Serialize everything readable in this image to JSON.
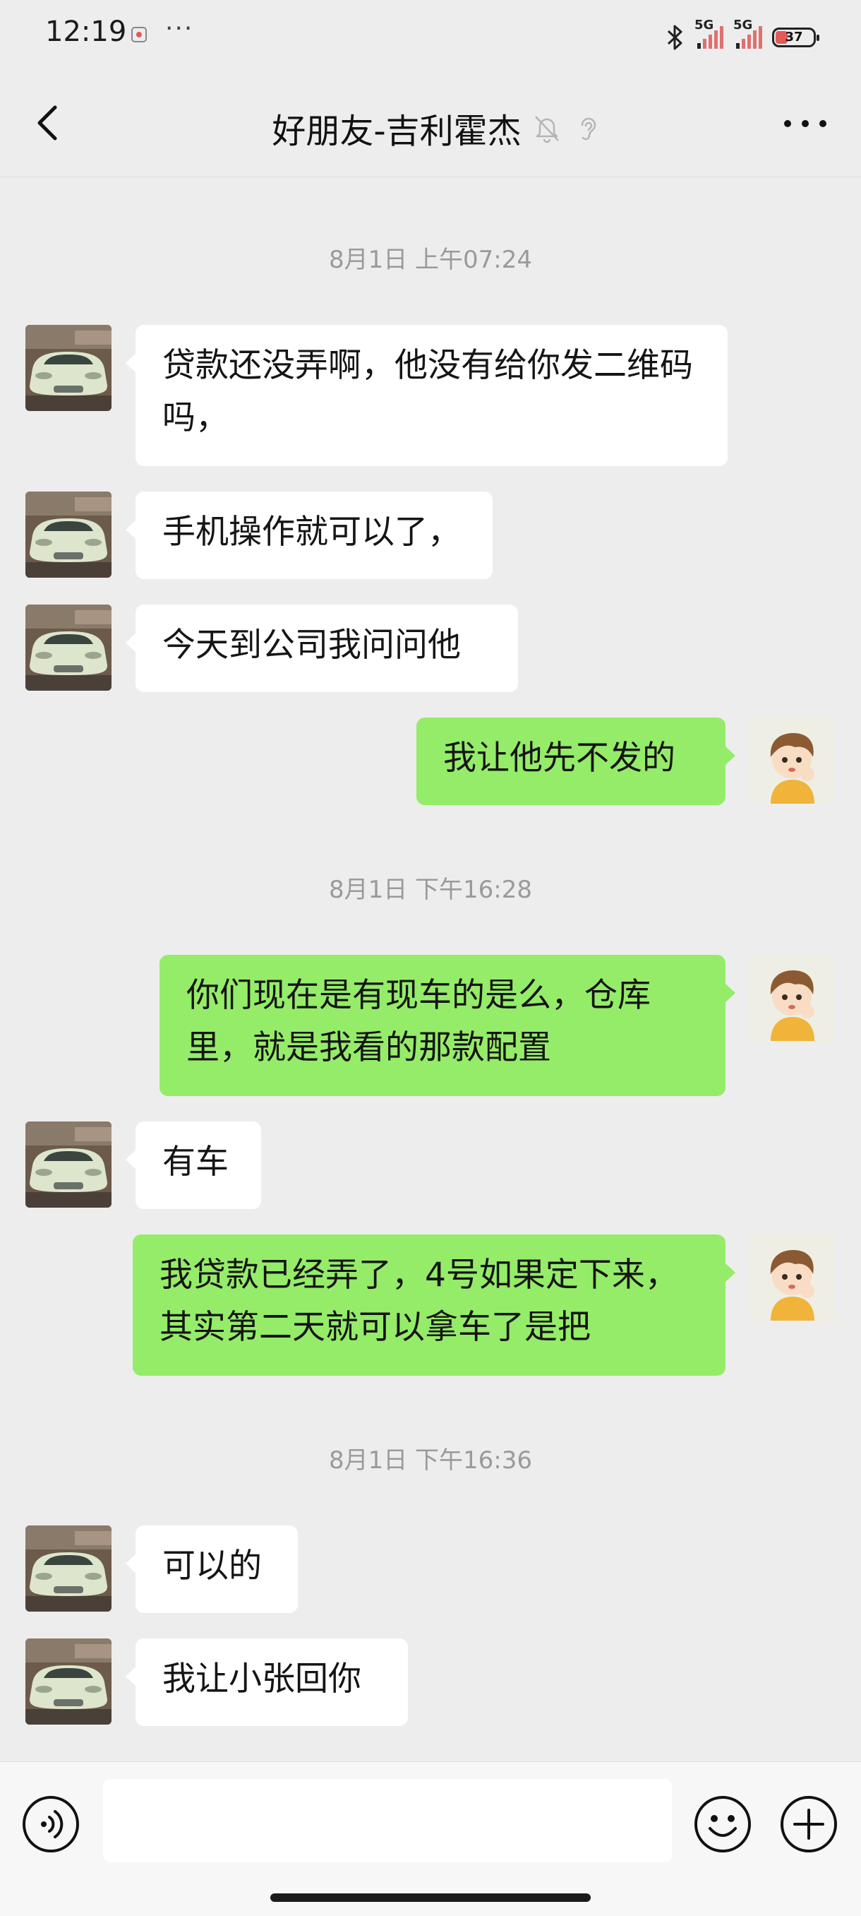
{
  "status_bar": {
    "time": "12:19",
    "more": "···",
    "network_1": "5G",
    "network_2": "5G",
    "battery": "37"
  },
  "header": {
    "title": "好朋友-吉利霍杰",
    "icons": [
      "back-icon",
      "mute-icon",
      "ear-icon",
      "more-icon"
    ]
  },
  "timestamps": [
    "8月1日 上午07:24",
    "8月1日 下午16:28",
    "8月1日 下午16:36"
  ],
  "messages": [
    {
      "from": "contact",
      "text": "贷款还没弄啊，他没有给你发二维码吗，"
    },
    {
      "from": "contact",
      "text": "手机操作就可以了，"
    },
    {
      "from": "contact",
      "text": "今天到公司我问问他"
    },
    {
      "from": "me",
      "text": "我让他先不发的"
    },
    {
      "from": "me",
      "text": "你们现在是有现车的是么，仓库里，就是我看的那款配置"
    },
    {
      "from": "contact",
      "text": "有车"
    },
    {
      "from": "me",
      "text": "我贷款已经弄了，4号如果定下来，其实第二天就可以拿车了是把"
    },
    {
      "from": "contact",
      "text": "可以的"
    },
    {
      "from": "contact",
      "text": "我让小张回你"
    }
  ],
  "input": {
    "value": ""
  },
  "colors": {
    "background": "#ededed",
    "outgoing_bubble": "#95ec69",
    "incoming_bubble": "#ffffff",
    "timestamp_text": "#9a9a9a"
  }
}
